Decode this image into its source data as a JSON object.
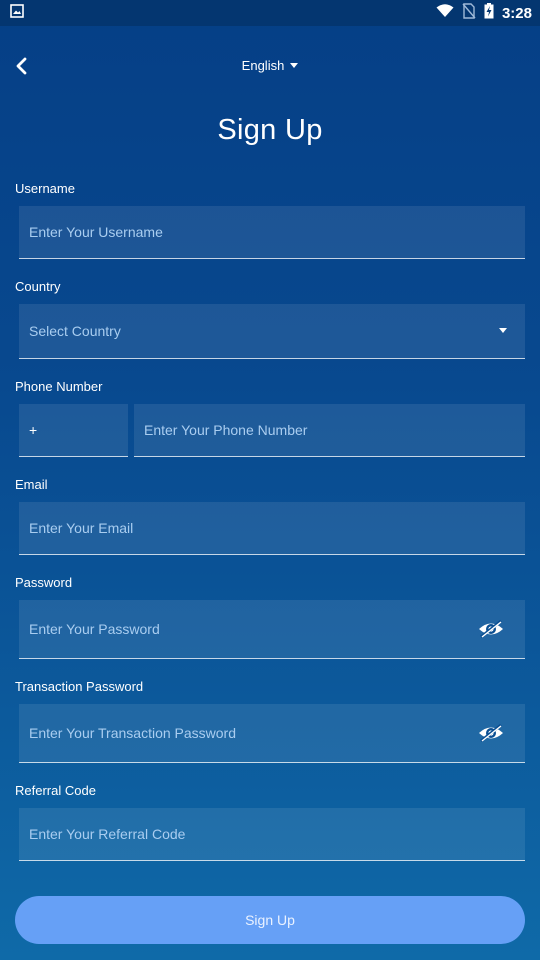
{
  "status_bar": {
    "time": "3:28",
    "icons": [
      "image-icon",
      "wifi-icon",
      "no-sim-icon",
      "battery-charging-icon"
    ]
  },
  "header": {
    "back_icon": "chevron-left-icon",
    "language": "English"
  },
  "title": "Sign Up",
  "form": {
    "username": {
      "label": "Username",
      "placeholder": "Enter Your Username"
    },
    "country": {
      "label": "Country",
      "placeholder": "Select Country"
    },
    "phone": {
      "label": "Phone Number",
      "code_prefix": "+",
      "placeholder": "Enter Your Phone Number"
    },
    "email": {
      "label": "Email",
      "placeholder": "Enter Your Email"
    },
    "password": {
      "label": "Password",
      "placeholder": "Enter Your Password",
      "toggle_icon": "eye-icon"
    },
    "transaction_password": {
      "label": "Transaction Password",
      "placeholder": "Enter Your Transaction Password",
      "toggle_icon": "eye-icon"
    },
    "referral": {
      "label": "Referral Code",
      "placeholder": "Enter Your Referral Code"
    }
  },
  "submit_label": "Sign Up",
  "colors": {
    "background_top": "#053f86",
    "background_bottom": "#0f6aa8",
    "button": "#66a0f6",
    "placeholder": "#a9cdf0"
  }
}
